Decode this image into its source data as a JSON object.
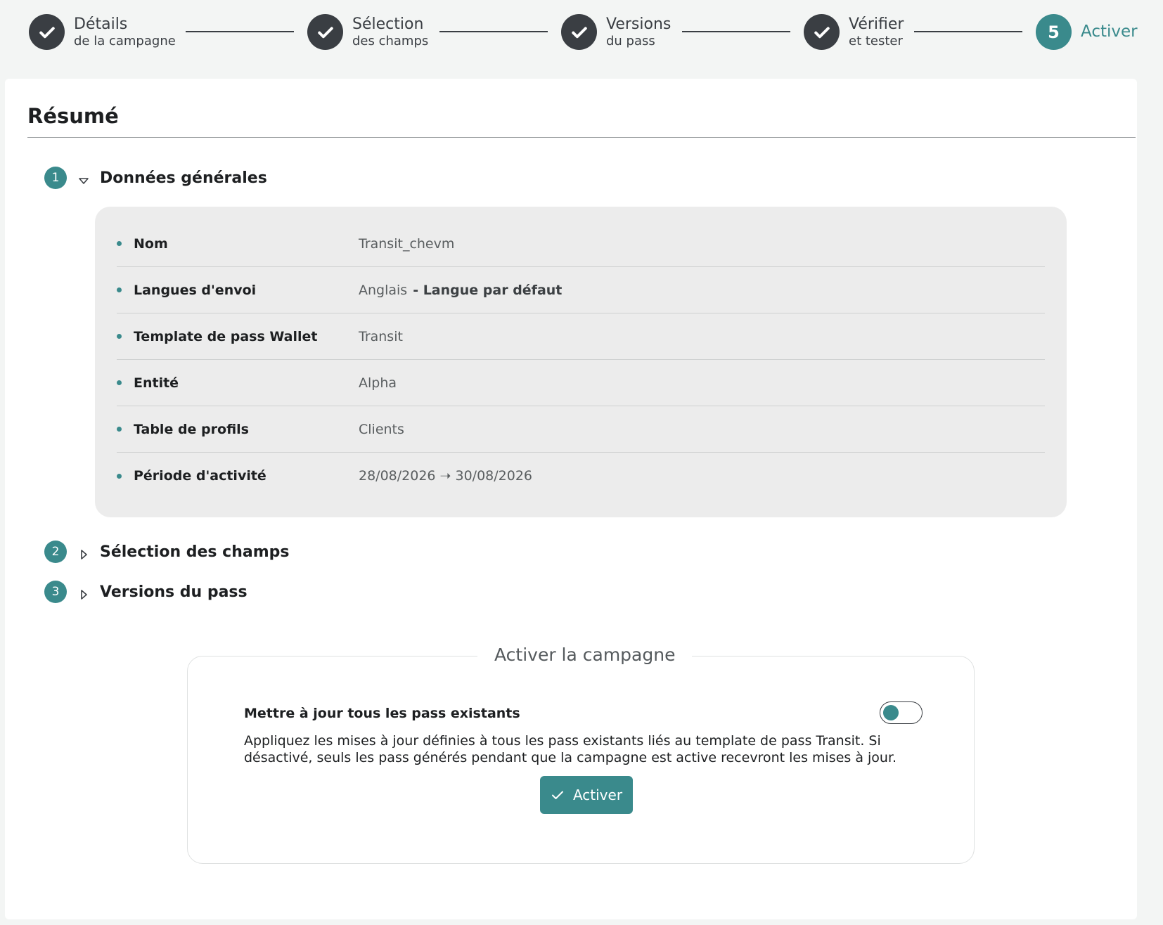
{
  "stepper": {
    "steps": [
      {
        "title": "Détails",
        "subtitle": "de la campagne",
        "state": "done"
      },
      {
        "title": "Sélection",
        "subtitle": "des champs",
        "state": "done"
      },
      {
        "title": "Versions",
        "subtitle": "du pass",
        "state": "done"
      },
      {
        "title": "Vérifier",
        "subtitle": "et tester",
        "state": "done"
      },
      {
        "number": "5",
        "title": "Activer",
        "state": "current"
      }
    ]
  },
  "summary": {
    "title": "Résumé",
    "sections": [
      {
        "number": "1",
        "label": "Données générales",
        "expanded": true
      },
      {
        "number": "2",
        "label": "Sélection des champs",
        "expanded": false
      },
      {
        "number": "3",
        "label": "Versions du pass",
        "expanded": false
      }
    ],
    "general_data": [
      {
        "label": "Nom",
        "value": "Transit_chevm"
      },
      {
        "label": "Langues d'envoi",
        "value": "Anglais",
        "extra": "- Langue par défaut"
      },
      {
        "label": "Template de pass Wallet",
        "value": "Transit"
      },
      {
        "label": "Entité",
        "value": "Alpha"
      },
      {
        "label": "Table de profils",
        "value": "Clients"
      },
      {
        "label": "Période d'activité",
        "value": "28/08/2026 ➝ 30/08/2026"
      }
    ]
  },
  "activation": {
    "legend": "Activer la campagne",
    "option_title": "Mettre à jour tous les pass existants",
    "option_description": "Appliquez les mises à jour définies à tous les pass existants liés au template de pass Transit. Si désactivé, seuls les pass générés pendant que la campagne est active recevront les mises à jour.",
    "toggle_on": false,
    "button_label": "Activer"
  },
  "colors": {
    "accent": "#3a8a8c",
    "dark": "#3a3e43",
    "panel": "#ececec"
  }
}
